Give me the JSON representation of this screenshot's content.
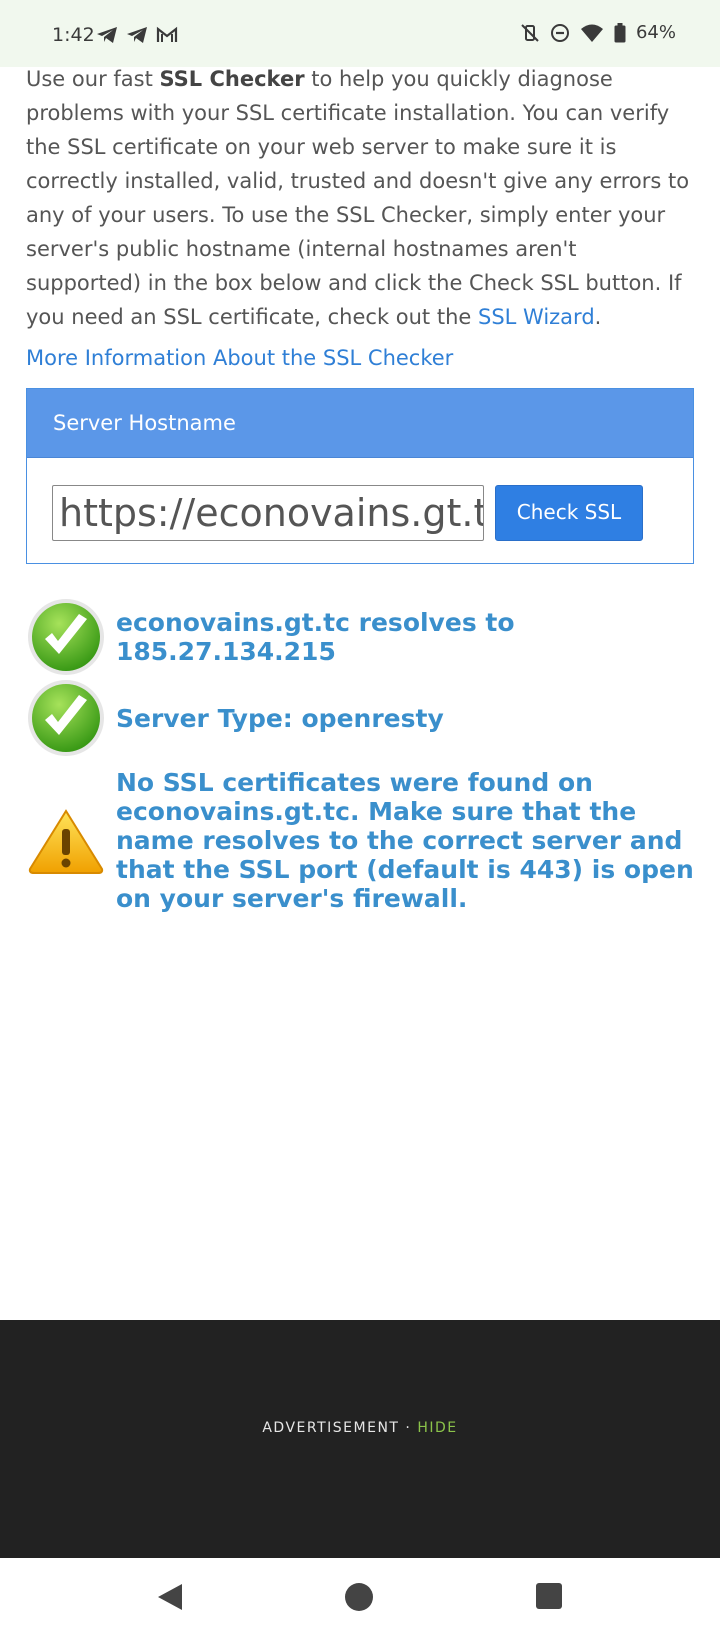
{
  "status_bar": {
    "time": "1:42",
    "left_icons": [
      "telegram-icon",
      "telegram-icon",
      "gmail-icon"
    ],
    "right_icons": [
      "vibrate-off-icon",
      "do-not-disturb-icon",
      "wifi-icon",
      "battery-icon"
    ],
    "battery": "64%"
  },
  "intro": {
    "part1": "Use our fast ",
    "bold": "SSL Checker",
    "part2": " to help you quickly diagnose problems with your SSL certificate installation. You can verify the SSL certificate on your web server to make sure it is correctly installed, valid, trusted and doesn't give any errors to any of your users. To use the SSL Checker, simply enter your server's public hostname (internal hostnames aren't supported) in the box below and click the Check SSL button. If you need an SSL certificate, check out the ",
    "link": "SSL Wizard",
    "part3": "."
  },
  "more_info_link": "More Information About the SSL Checker",
  "panel": {
    "title": "Server Hostname",
    "input_value": "https://econovains.gt.tc",
    "button_label": "Check SSL"
  },
  "results": [
    {
      "icon": "check-icon",
      "text": "econovains.gt.tc resolves to 185.27.134.215"
    },
    {
      "icon": "check-icon",
      "text": "Server Type: openresty"
    },
    {
      "icon": "warning-icon",
      "text": "No SSL certificates were found on econovains.gt.tc. Make sure that the name resolves to the correct server and that the SSL port (default is 443) is open on your server's firewall."
    }
  ],
  "ad": {
    "label": "ADVERTISEMENT",
    "separator": "·",
    "hide": "HIDE"
  },
  "colors": {
    "link": "#2f7fd6",
    "result_text": "#3a8fcc",
    "panel_header": "#5b97e8",
    "button": "#2f7fe3",
    "ad_background": "#222222",
    "hide": "#8bc34a"
  }
}
